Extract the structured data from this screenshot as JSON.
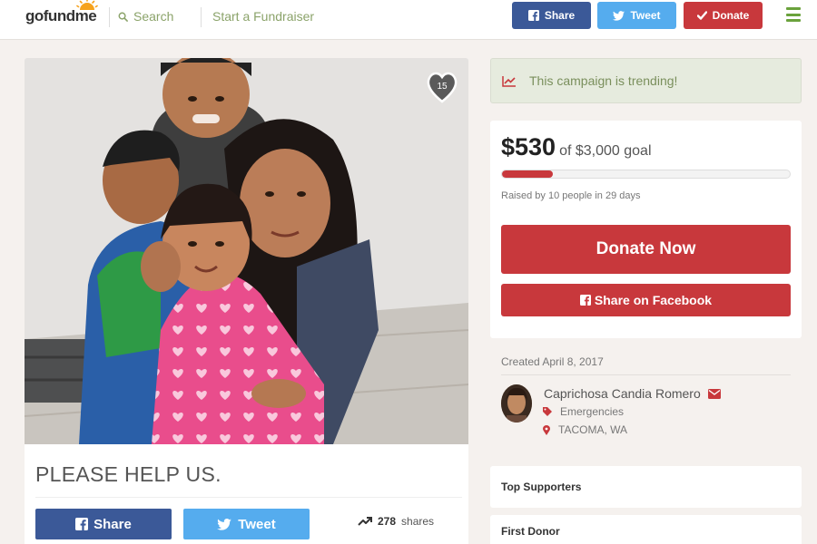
{
  "header": {
    "logo": "gofundme",
    "search_label": "Search",
    "start_label": "Start a Fundraiser",
    "share_label": "Share",
    "tweet_label": "Tweet",
    "donate_label": "Donate"
  },
  "campaign": {
    "heart_count": "15",
    "title": "PLEASE HELP US.",
    "share_label": "Share",
    "tweet_label": "Tweet",
    "shares_count": "278",
    "shares_label": "shares"
  },
  "sidebar": {
    "trending_text": "This campaign is trending!",
    "raised": "$530",
    "goal_text": "of $3,000 goal",
    "progress_fraction": 0.1767,
    "raised_by": "Raised by 10 people in 29 days",
    "donate_now_label": "Donate Now",
    "share_facebook_label": "Share on Facebook",
    "created": "Created April 8, 2017",
    "organizer_name": "Caprichosa Candia Romero",
    "category": "Emergencies",
    "location": "TACOMA, WA",
    "top_supporters": "Top Supporters",
    "first_donor": "First Donor"
  },
  "icons": {
    "search": "search-icon",
    "facebook": "facebook-icon",
    "twitter": "twitter-icon",
    "check": "checkmark-icon",
    "menu": "hamburger-menu-icon",
    "heart": "heart-icon",
    "trend": "trending-icon",
    "mail": "envelope-icon",
    "tag": "tag-icon",
    "pin": "location-pin-icon"
  },
  "colors": {
    "brand_green": "#6aa23c",
    "facebook_blue": "#3b5998",
    "twitter_blue": "#55acee",
    "donate_red": "#c8383c",
    "trending_bg": "#e6ebde"
  }
}
